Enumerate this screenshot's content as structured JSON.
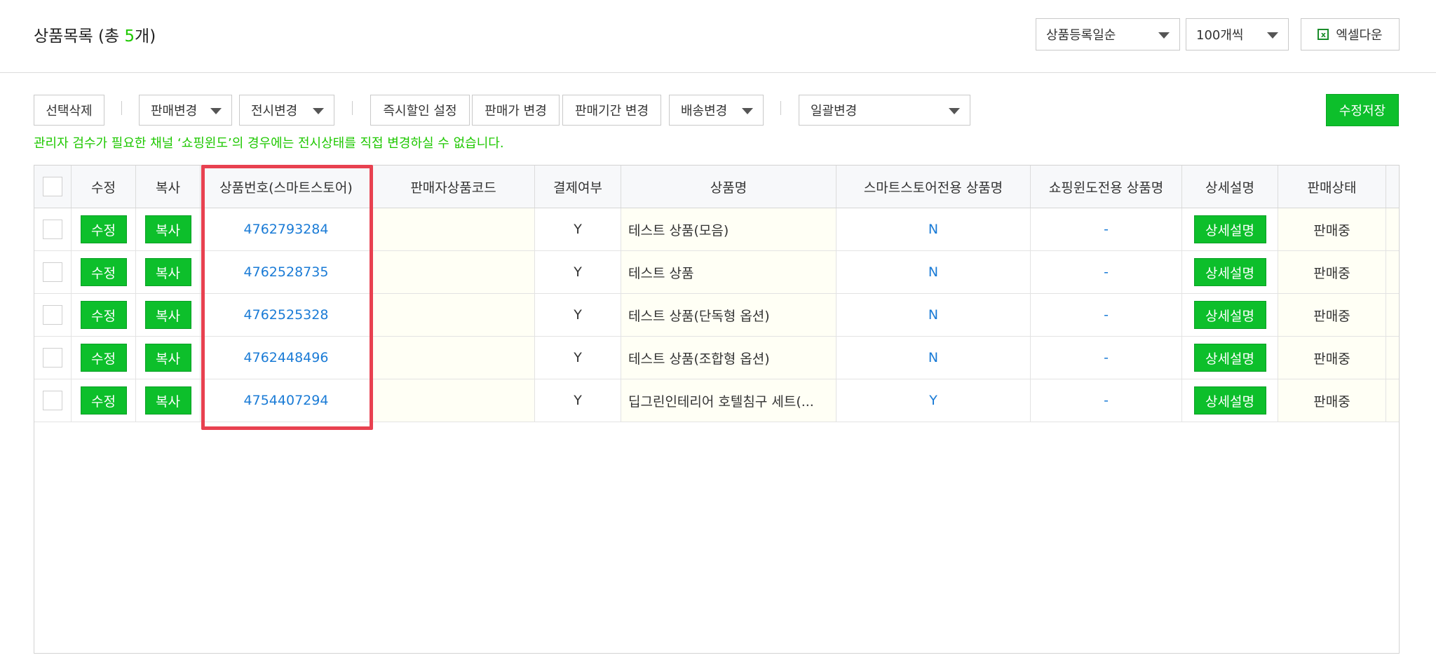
{
  "header": {
    "title_prefix": "상품목록 (총 ",
    "title_count": "5",
    "title_suffix": "개)",
    "sort_select": "상품등록일순",
    "page_size_select": "100개씩",
    "excel_label": "엑셀다운"
  },
  "toolbar": {
    "delete_selected": "선택삭제",
    "sale_change": "판매변경",
    "display_change": "전시변경",
    "instant_discount": "즉시할인 설정",
    "price_change": "판매가 변경",
    "period_change": "판매기간 변경",
    "delivery_change": "배송변경",
    "bulk_change": "일괄변경",
    "save": "수정저장"
  },
  "notice": "관리자 검수가 필요한 채널 ‘쇼핑윈도’의 경우에는 전시상태를 직접 변경하실 수 없습니다.",
  "table": {
    "headers": [
      "수정",
      "복사",
      "상품번호(스마트스토어)",
      "판매자상품코드",
      "결제여부",
      "상품명",
      "스마트스토어전용 상품명",
      "쇼핑윈도전용 상품명",
      "상세설명",
      "판매상태"
    ],
    "edit_label": "수정",
    "copy_label": "복사",
    "detail_label": "상세설명",
    "rows": [
      {
        "id": "4762793284",
        "code": "",
        "paid": "Y",
        "name": "테스트 상품(모음)",
        "ss_name": "N",
        "sw_name": "-",
        "status": "판매중"
      },
      {
        "id": "4762528735",
        "code": "",
        "paid": "Y",
        "name": "테스트 상품",
        "ss_name": "N",
        "sw_name": "-",
        "status": "판매중"
      },
      {
        "id": "4762525328",
        "code": "",
        "paid": "Y",
        "name": "테스트 상품(단독형 옵션)",
        "ss_name": "N",
        "sw_name": "-",
        "status": "판매중"
      },
      {
        "id": "4762448496",
        "code": "",
        "paid": "Y",
        "name": "테스트 상품(조합형 옵션)",
        "ss_name": "N",
        "sw_name": "-",
        "status": "판매중"
      },
      {
        "id": "4754407294",
        "code": "",
        "paid": "Y",
        "name": "딥그린인테리어 호텔침구 세트(...",
        "ss_name": "Y",
        "sw_name": "-",
        "status": "판매중"
      }
    ]
  },
  "colors": {
    "accent_green": "#0dbf2b",
    "notice_green": "#1ec800",
    "link_blue": "#1a7bd6",
    "highlight_red": "#e84150"
  }
}
